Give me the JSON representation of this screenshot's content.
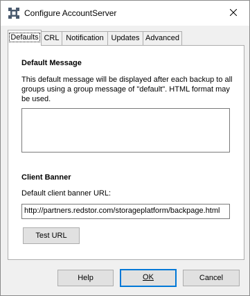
{
  "window": {
    "title": "Configure AccountServer",
    "app_icon": "app-gear-icon",
    "close_icon": "close-icon"
  },
  "tabs": [
    {
      "label": "Defaults",
      "active": true
    },
    {
      "label": "CRL",
      "active": false
    },
    {
      "label": "Notification",
      "active": false
    },
    {
      "label": "Updates",
      "active": false
    },
    {
      "label": "Advanced",
      "active": false
    }
  ],
  "defaults": {
    "default_message": {
      "heading": "Default Message",
      "description": "This default message will be displayed after each backup to all groups using a group message of \"default\". HTML format may be used.",
      "value": ""
    },
    "client_banner": {
      "heading": "Client Banner",
      "url_label": "Default client banner URL:",
      "url_value": "http://partners.redstor.com/storageplatform/backpage.html",
      "test_button": "Test URL"
    }
  },
  "footer": {
    "help": "Help",
    "ok": "OK",
    "cancel": "Cancel"
  },
  "colors": {
    "focus_border": "#0078d7",
    "button_face": "#e1e1e1",
    "window_bg": "#f0f0f0"
  }
}
